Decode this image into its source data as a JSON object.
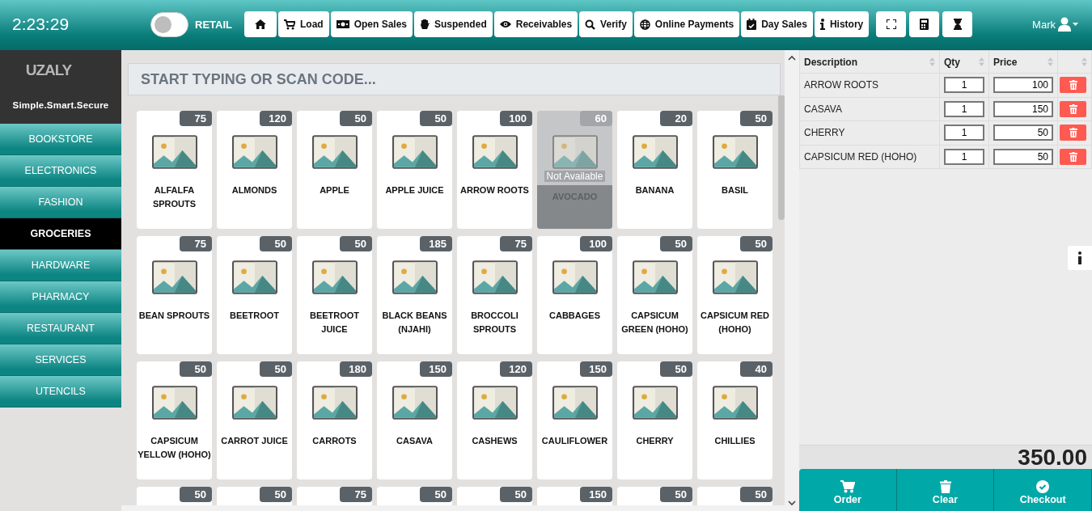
{
  "header": {
    "clock": "2:23:29",
    "mode_toggle": {
      "label": "RETAIL",
      "on": false
    },
    "toolbar": [
      {
        "label": "Load"
      },
      {
        "label": "Open Sales"
      },
      {
        "label": "Suspended"
      },
      {
        "label": "Receivables"
      },
      {
        "label": "Verify"
      },
      {
        "label": "Online Payments"
      },
      {
        "label": "Day Sales"
      },
      {
        "label": "History"
      }
    ],
    "user": "Mark"
  },
  "sidebar": {
    "logo": "UZALY",
    "tagline": "Simple.Smart.Secure",
    "categories": [
      {
        "label": "BOOKSTORE",
        "selected": false
      },
      {
        "label": "ELECTRONICS",
        "selected": false
      },
      {
        "label": "FASHION",
        "selected": false
      },
      {
        "label": "GROCERIES",
        "selected": true
      },
      {
        "label": "HARDWARE",
        "selected": false
      },
      {
        "label": "PHARMACY",
        "selected": false
      },
      {
        "label": "RESTAURANT",
        "selected": false
      },
      {
        "label": "SERVICES",
        "selected": false
      },
      {
        "label": "UTENCILS",
        "selected": false
      }
    ]
  },
  "search": {
    "placeholder": "START TYPING OR SCAN CODE..."
  },
  "products": [
    {
      "name": "ALFALFA SPROUTS",
      "count": "75",
      "available": true
    },
    {
      "name": "ALMONDS",
      "count": "120",
      "available": true
    },
    {
      "name": "APPLE",
      "count": "50",
      "available": true
    },
    {
      "name": "APPLE JUICE",
      "count": "50",
      "available": true
    },
    {
      "name": "ARROW ROOTS",
      "count": "100",
      "available": true
    },
    {
      "name": "AVOCADO",
      "count": "60",
      "available": false,
      "note": "Not Available"
    },
    {
      "name": "BANANA",
      "count": "20",
      "available": true
    },
    {
      "name": "BASIL",
      "count": "50",
      "available": true
    },
    {
      "name": "BEAN SPROUTS",
      "count": "75",
      "available": true
    },
    {
      "name": "BEETROOT",
      "count": "50",
      "available": true
    },
    {
      "name": "BEETROOT JUICE",
      "count": "50",
      "available": true
    },
    {
      "name": "BLACK BEANS (NJAHI)",
      "count": "185",
      "available": true
    },
    {
      "name": "BROCCOLI SPROUTS",
      "count": "75",
      "available": true
    },
    {
      "name": "CABBAGES",
      "count": "100",
      "available": true
    },
    {
      "name": "CAPSICUM GREEN (HOHO)",
      "count": "50",
      "available": true
    },
    {
      "name": "CAPSICUM RED (HOHO)",
      "count": "50",
      "available": true
    },
    {
      "name": "CAPSICUM YELLOW (HOHO)",
      "count": "50",
      "available": true
    },
    {
      "name": "CARROT JUICE",
      "count": "50",
      "available": true
    },
    {
      "name": "CARROTS",
      "count": "180",
      "available": true
    },
    {
      "name": "CASAVA",
      "count": "150",
      "available": true
    },
    {
      "name": "CASHEWS",
      "count": "120",
      "available": true
    },
    {
      "name": "CAULIFLOWER",
      "count": "150",
      "available": true
    },
    {
      "name": "CHERRY",
      "count": "50",
      "available": true
    },
    {
      "name": "CHILLIES",
      "count": "40",
      "available": true
    },
    {
      "count": "50",
      "available": true
    },
    {
      "count": "50",
      "available": true
    },
    {
      "count": "75",
      "available": true
    },
    {
      "count": "50",
      "available": true
    },
    {
      "count": "50",
      "available": true
    },
    {
      "count": "150",
      "available": true
    },
    {
      "count": "50",
      "available": true
    },
    {
      "count": "50",
      "available": true
    }
  ],
  "cart": {
    "columns": [
      "Description",
      "Qty",
      "Price"
    ],
    "rows": [
      {
        "description": "ARROW ROOTS",
        "qty": "1",
        "price": "100"
      },
      {
        "description": "CASAVA",
        "qty": "1",
        "price": "150"
      },
      {
        "description": "CHERRY",
        "qty": "1",
        "price": "50"
      },
      {
        "description": "CAPSICUM RED (HOHO)",
        "qty": "1",
        "price": "50"
      }
    ],
    "total": "350.00",
    "actions": [
      {
        "label": "Order"
      },
      {
        "label": "Clear"
      },
      {
        "label": "Checkout"
      }
    ]
  }
}
